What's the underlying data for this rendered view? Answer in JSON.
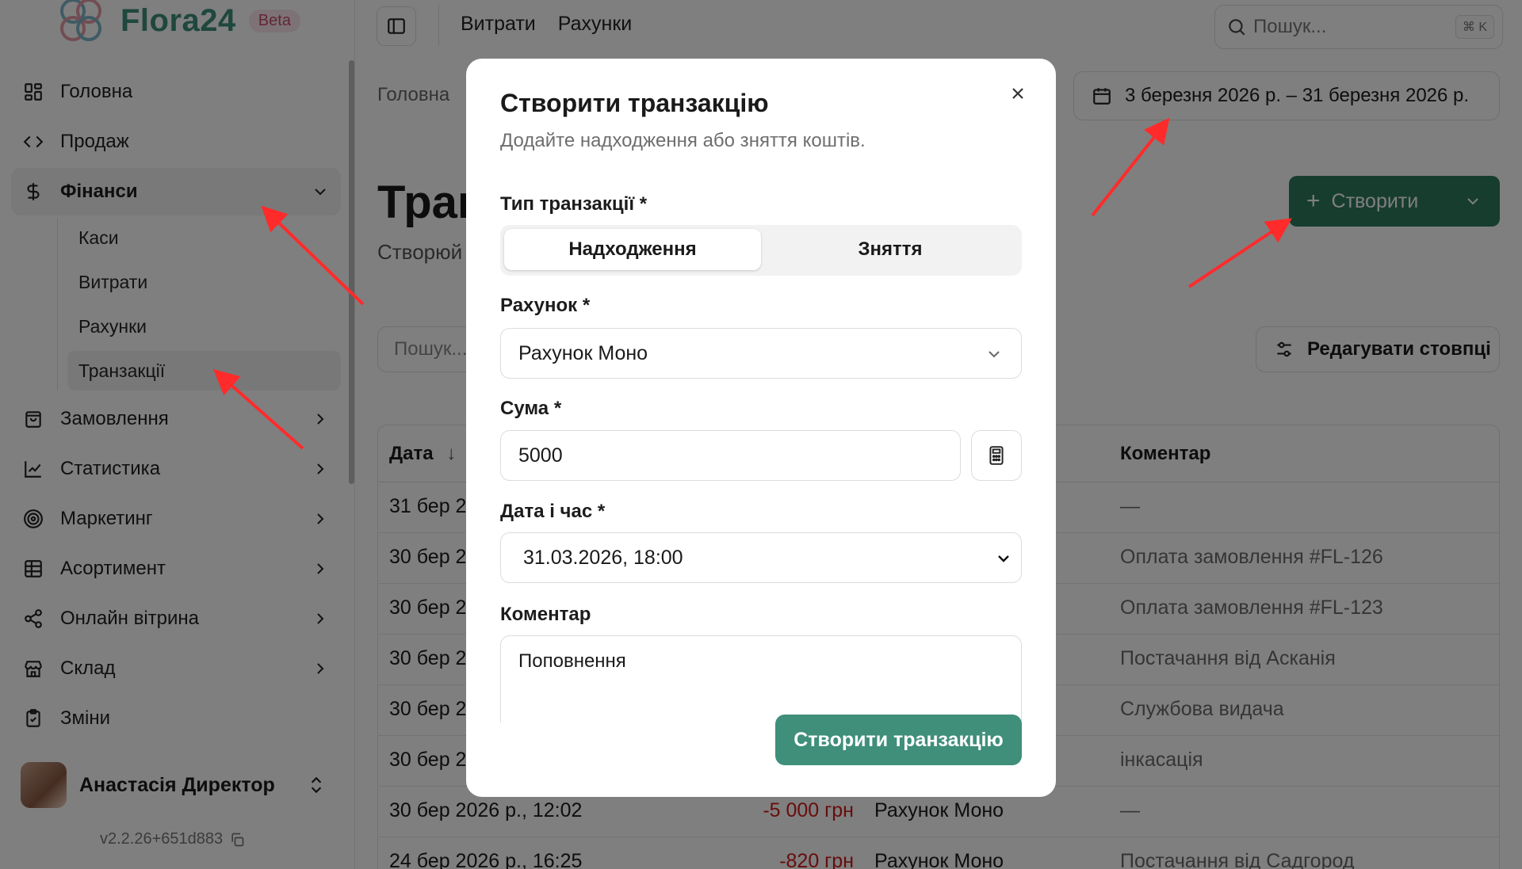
{
  "brand": {
    "name": "Flora24",
    "badge": "Beta"
  },
  "sidebar": {
    "items": [
      {
        "label": "Головна",
        "icon": "dashboard-icon"
      },
      {
        "label": "Продаж",
        "icon": "code-icon"
      },
      {
        "label": "Фінанси",
        "icon": "dollar-icon",
        "open": true,
        "children": [
          {
            "label": "Каси"
          },
          {
            "label": "Витрати"
          },
          {
            "label": "Рахунки"
          },
          {
            "label": "Транзакції",
            "active": true
          }
        ]
      },
      {
        "label": "Замовлення",
        "icon": "shopping-bag-icon"
      },
      {
        "label": "Статистика",
        "icon": "chart-line-icon"
      },
      {
        "label": "Маркетинг",
        "icon": "target-icon"
      },
      {
        "label": "Асортимент",
        "icon": "grid-table-icon"
      },
      {
        "label": "Онлайн вітрина",
        "icon": "share-icon"
      },
      {
        "label": "Склад",
        "icon": "store-icon"
      },
      {
        "label": "Зміни",
        "icon": "clipboard-check-icon"
      }
    ],
    "user": {
      "name": "Анастасія Директор"
    },
    "version": "v2.2.26+651d883"
  },
  "topbar": {
    "tabs": [
      "Витрати",
      "Рахунки"
    ],
    "search_placeholder": "Пошук...",
    "search_shortcut": "⌘ K"
  },
  "page": {
    "breadcrumb": "Головна",
    "date_range": "3 березня 2026 р. – 31 березня 2026 р.",
    "title": "Тран",
    "subtitle": "Створюй",
    "create_label": "Створити",
    "table_search_placeholder": "Пошук...",
    "edit_columns_label": "Редагувати стовпці"
  },
  "table": {
    "headers": {
      "date": "Дата",
      "comment": "Коментар"
    },
    "rows": [
      {
        "date": "31 бер 2",
        "amount": "",
        "account": "",
        "comment": "—"
      },
      {
        "date": "30 бер 2",
        "amount": "",
        "account": "",
        "comment": "Оплата замовлення #FL-126"
      },
      {
        "date": "30 бер 2",
        "amount": "",
        "account": "",
        "comment": "Оплата замовлення #FL-123"
      },
      {
        "date": "30 бер 2",
        "amount": "",
        "account": "",
        "comment": "Постачання від Асканія"
      },
      {
        "date": "30 бер 2",
        "amount": "",
        "account": "",
        "comment": "Службова видача"
      },
      {
        "date": "30 бер 2",
        "amount": "",
        "account": "",
        "comment": "інкасація"
      },
      {
        "date": "30 бер 2026 р., 12:02",
        "amount": "-5 000 грн",
        "account": "Рахунок Моно",
        "comment": "—"
      },
      {
        "date": "24 бер 2026 р., 16:25",
        "amount": "-820 грн",
        "account": "Рахунок Моно",
        "comment": "Постачання від Садгород"
      }
    ]
  },
  "modal": {
    "title": "Створити транзакцію",
    "description": "Додайте надходження або зняття коштів.",
    "type_label": "Тип транзакції *",
    "type_options": [
      "Надходження",
      "Зняття"
    ],
    "type_selected": "Надходження",
    "account_label": "Рахунок *",
    "account_value": "Рахунок Моно",
    "amount_label": "Сума *",
    "amount_value": "5000",
    "datetime_label": "Дата і час *",
    "datetime_value": "31.03.2026, 18:00",
    "comment_label": "Коментар",
    "comment_value": "Поповнення",
    "submit_label": "Створити транзакцію"
  },
  "colors": {
    "brand_green": "#3f8f7a",
    "primary_button": "#2f7a5f",
    "negative": "#d11a1a",
    "annotation_arrow": "#ff2b2b"
  }
}
